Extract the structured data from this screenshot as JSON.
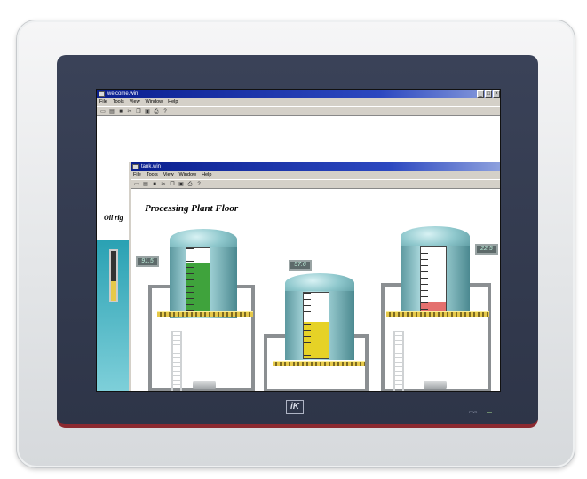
{
  "back_window": {
    "title": "welcome.win",
    "menu": [
      "File",
      "Tools",
      "View",
      "Window",
      "Help"
    ],
    "caption": "Oil rig"
  },
  "front_window": {
    "title": "tank.win",
    "menu": [
      "File",
      "Tools",
      "View",
      "Window",
      "Help"
    ],
    "heading": "Processing Plant Floor"
  },
  "readouts": {
    "left": "91.5",
    "center": "57.6",
    "right": "22.5"
  },
  "tanks": [
    {
      "name": "tank-left",
      "level": 0.78,
      "color": "#3fa33c"
    },
    {
      "name": "tank-center",
      "level": 0.55,
      "color": "#e6d226"
    },
    {
      "name": "tank-right",
      "level": 0.18,
      "color": "#e4706e"
    }
  ],
  "toolbar_icons": [
    "new-file-icon",
    "open-folder-icon",
    "save-icon",
    "cut-icon",
    "copy-icon",
    "paste-icon",
    "print-icon",
    "help-icon"
  ],
  "device": {
    "logo": "iK"
  }
}
